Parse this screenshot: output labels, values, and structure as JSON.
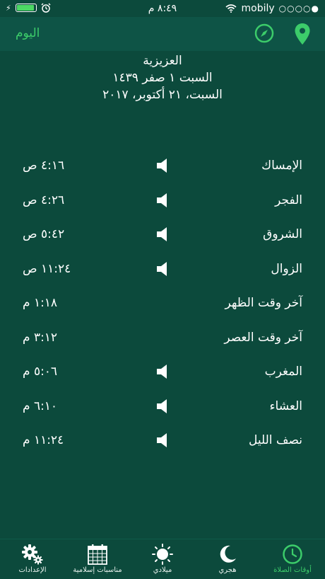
{
  "status_bar": {
    "time": "٨:٤٩ م",
    "carrier": "mobily",
    "signal_dots": "○○○○●"
  },
  "nav": {
    "today_label": "اليوم"
  },
  "header": {
    "city": "العزيزية",
    "hijri_date": "السبت ١ صفر ١٤٣٩",
    "gregorian_date": "السبت، ٢١ أكتوبر، ٢٠١٧"
  },
  "prayers": [
    {
      "name": "الإمساك",
      "time": "٤:١٦ ص",
      "sound": true
    },
    {
      "name": "الفجر",
      "time": "٤:٢٦ ص",
      "sound": true
    },
    {
      "name": "الشروق",
      "time": "٥:٤٢ ص",
      "sound": true
    },
    {
      "name": "الزوال",
      "time": "١١:٢٤ ص",
      "sound": true
    },
    {
      "name": "آخر وقت الظهر",
      "time": "١:١٨ م",
      "sound": false
    },
    {
      "name": "آخر وقت العصر",
      "time": "٣:١٢ م",
      "sound": false
    },
    {
      "name": "المغرب",
      "time": "٥:٠٦ م",
      "sound": true
    },
    {
      "name": "العشاء",
      "time": "٦:١٠ م",
      "sound": true
    },
    {
      "name": "نصف الليل",
      "time": "١١:٢٤ م",
      "sound": true
    }
  ],
  "tabs": [
    {
      "label": "الإعدادات",
      "icon": "gear-icon"
    },
    {
      "label": "مناسبات إسلامية",
      "icon": "calendar-icon"
    },
    {
      "label": "ميلادي",
      "icon": "sun-icon"
    },
    {
      "label": "هجري",
      "icon": "moon-icon"
    },
    {
      "label": "أوقات الصلاة",
      "icon": "clock-icon",
      "active": true
    }
  ],
  "colors": {
    "background": "#0c4a3c",
    "nav_background": "#0e5446",
    "accent": "#3ccc6a"
  }
}
